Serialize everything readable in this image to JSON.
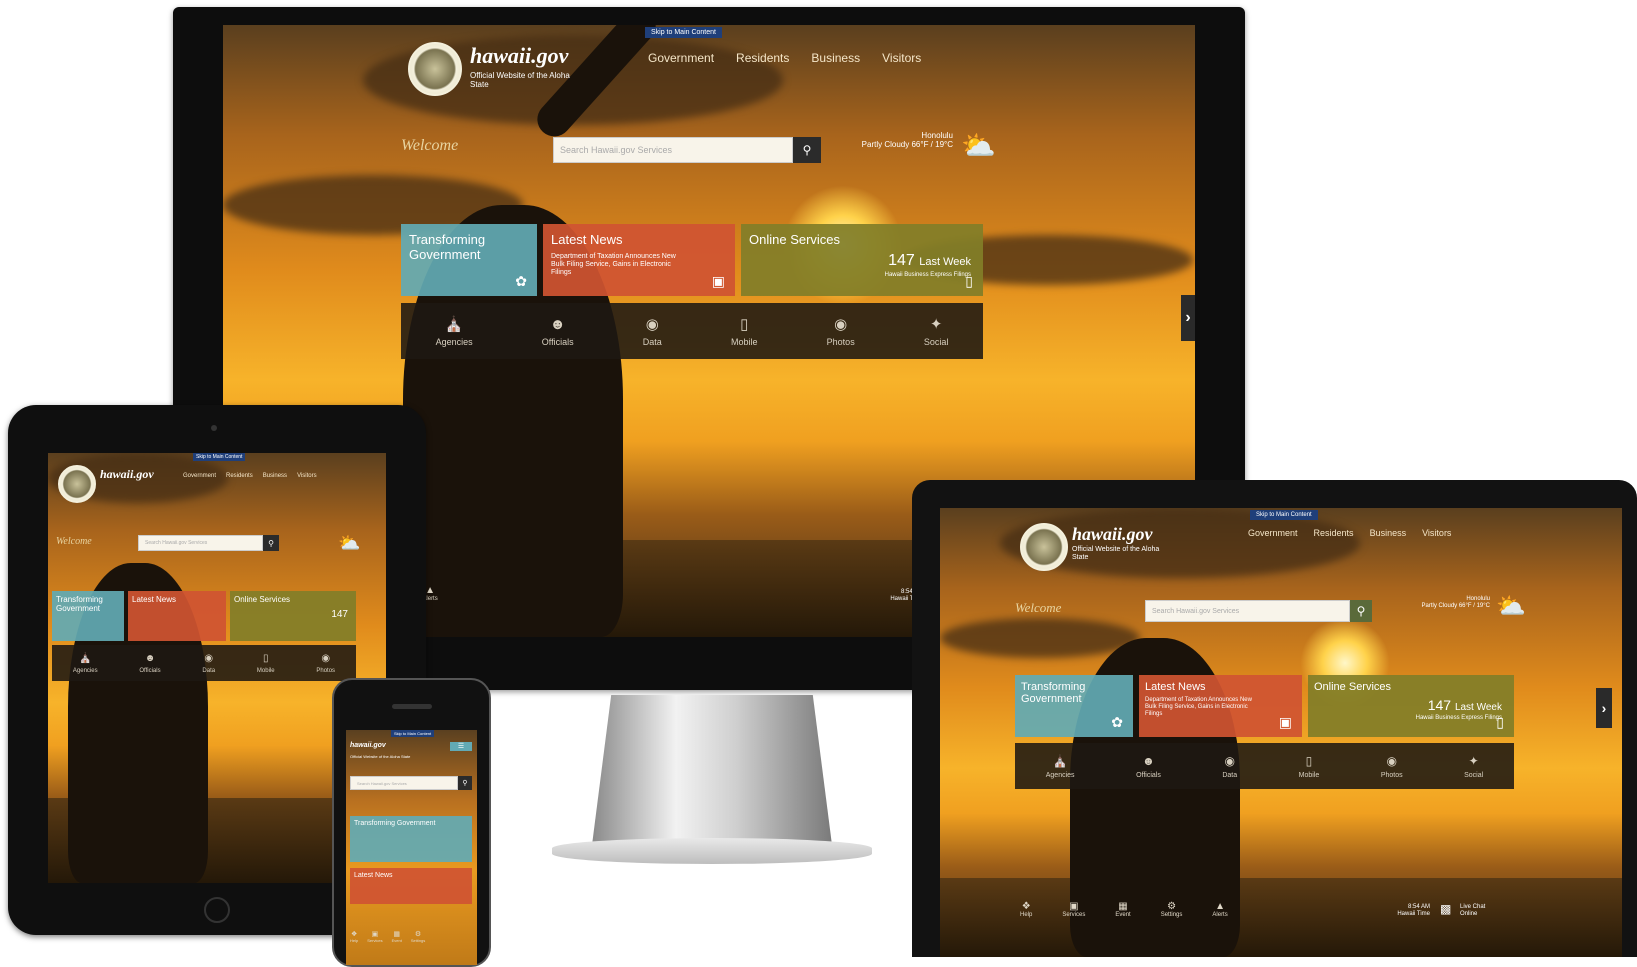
{
  "site": {
    "logo_text": "hawaii.gov",
    "logo_sub": "Official Website of the Aloha State",
    "skip_link": "Skip to Main Content",
    "welcome": "Welcome",
    "search_placeholder": "Search Hawaii.gov Services",
    "nav": [
      "Government",
      "Residents",
      "Business",
      "Visitors"
    ],
    "weather": {
      "place": "Honolulu",
      "details": "Partly Cloudy 66°F / 19°C"
    }
  },
  "tiles": {
    "transforming": {
      "title": "Transforming Government"
    },
    "news": {
      "title": "Latest News",
      "text": "Department of Taxation Announces New Bulk Filing Service, Gains in Electronic Filings"
    },
    "services": {
      "title": "Online Services",
      "count": "147",
      "count_label": "Last Week",
      "sub": "Hawaii Business Express Filings"
    }
  },
  "iconbar": [
    {
      "label": "Agencies",
      "icon": "building-icon"
    },
    {
      "label": "Officials",
      "icon": "people-icon"
    },
    {
      "label": "Data",
      "icon": "globe-icon"
    },
    {
      "label": "Mobile",
      "icon": "mobile-icon"
    },
    {
      "label": "Photos",
      "icon": "camera-icon"
    },
    {
      "label": "Social",
      "icon": "twitter-icon"
    }
  ],
  "bottombar": [
    "Help",
    "Services",
    "Event",
    "Settings",
    "Alerts"
  ],
  "clock": {
    "time": "8:54 AM",
    "label": "Hawaii Time"
  },
  "chat": {
    "label": "Live Chat Online"
  },
  "colors": {
    "tile_blue": "#62aab4",
    "tile_red": "#d05432",
    "tile_olive": "#827e28"
  }
}
